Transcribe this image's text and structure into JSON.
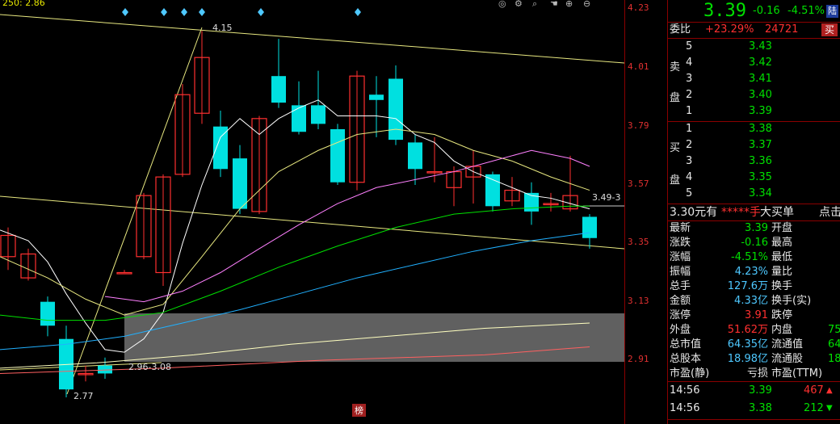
{
  "chart": {
    "top_left_label": "250: 2.86",
    "y_ticks": [
      "4.23",
      "4.01",
      "3.79",
      "3.57",
      "3.35",
      "3.13",
      "2.91"
    ],
    "annotations": {
      "high": "4.15",
      "low": "2.77",
      "range_label": "2.96-3.08",
      "right_label": "3.49-3",
      "badge": "榜"
    },
    "icons": [
      "target-icon",
      "settings-icon",
      "search-icon",
      "hand-icon",
      "zoom-in-icon",
      "zoom-out-icon"
    ]
  },
  "quote": {
    "price": "3.39",
    "change": "-0.16",
    "change_pct": "-4.51%",
    "flag": "陆"
  },
  "weibi": {
    "label": "委比",
    "pct": "+23.29%",
    "diff": "24721",
    "btn": "买"
  },
  "sell_side": {
    "label1": "卖",
    "label2": "盘",
    "levels": [
      {
        "n": "5",
        "price": "3.43"
      },
      {
        "n": "4",
        "price": "3.42"
      },
      {
        "n": "3",
        "price": "3.41"
      },
      {
        "n": "2",
        "price": "3.40"
      },
      {
        "n": "1",
        "price": "3.39"
      }
    ]
  },
  "buy_side": {
    "label1": "买",
    "label2": "盘",
    "levels": [
      {
        "n": "1",
        "price": "3.38"
      },
      {
        "n": "2",
        "price": "3.37"
      },
      {
        "n": "3",
        "price": "3.36"
      },
      {
        "n": "4",
        "price": "3.35"
      },
      {
        "n": "5",
        "price": "3.34"
      }
    ]
  },
  "bigorder": {
    "price": "3.30元有",
    "stars": "*****手",
    "label": "大买单",
    "more": "点击"
  },
  "stats": [
    {
      "l": "最新",
      "v": "3.39",
      "vc": "green",
      "r": "开盘",
      "rv": ""
    },
    {
      "l": "涨跌",
      "v": "-0.16",
      "vc": "green",
      "r": "最高",
      "rv": ""
    },
    {
      "l": "涨幅",
      "v": "-4.51%",
      "vc": "green",
      "r": "最低",
      "rv": ""
    },
    {
      "l": "振幅",
      "v": "4.23%",
      "vc": "cyan",
      "r": "量比",
      "rv": ""
    },
    {
      "l": "总手",
      "v": "127.6万",
      "vc": "cyan",
      "r": "换手",
      "rv": ""
    },
    {
      "l": "金额",
      "v": "4.33亿",
      "vc": "cyan",
      "r": "换手(实)",
      "rv": ""
    },
    {
      "l": "涨停",
      "v": "3.91",
      "vc": "red",
      "r": "跌停",
      "rv": ""
    },
    {
      "l": "外盘",
      "v": "51.62万",
      "vc": "red",
      "r": "内盘",
      "rv": "75"
    },
    {
      "l": "总市值",
      "v": "64.35亿",
      "vc": "cyan",
      "r": "流通值",
      "rv": "64"
    },
    {
      "l": "总股本",
      "v": "18.98亿",
      "vc": "cyan",
      "r": "流通股",
      "rv": "18"
    },
    {
      "l": "市盈(静)",
      "v": "亏损",
      "vc": "white",
      "r": "市盈(TTM)",
      "rv": ""
    }
  ],
  "ticks": [
    {
      "time": "14:56",
      "price": "3.39",
      "vol": "467",
      "dir": "up"
    },
    {
      "time": "14:56",
      "price": "3.38",
      "vol": "212",
      "dir": "down"
    }
  ],
  "colors": {
    "up": "#ff3030",
    "down": "#00e0e0",
    "ma5": "#ffffff",
    "ma10": "#e8e880",
    "ma20": "#ff80ff",
    "ma30": "#00e000",
    "ma60": "#20b0ff",
    "axis": "#8b0000"
  }
}
